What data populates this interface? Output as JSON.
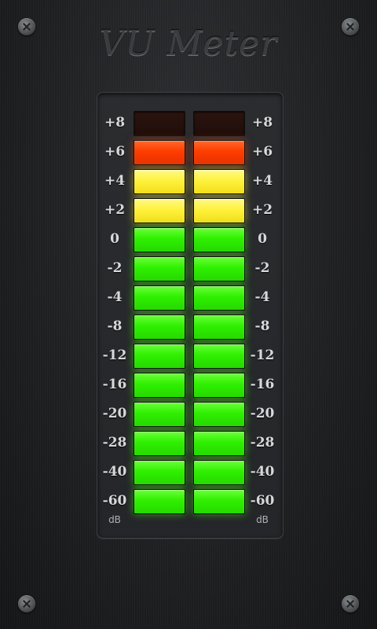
{
  "app": {
    "title": "VU Meter"
  },
  "meter": {
    "unit_left": "dB",
    "unit_right": "dB",
    "rows": [
      {
        "label": "+8",
        "color": "#2b1410",
        "state": "off",
        "left_lit": false,
        "right_lit": false
      },
      {
        "label": "+6",
        "color": "#ff3d00",
        "state": "red",
        "left_lit": true,
        "right_lit": true
      },
      {
        "label": "+4",
        "color": "#fff23d",
        "state": "yellow",
        "left_lit": true,
        "right_lit": true
      },
      {
        "label": "+2",
        "color": "#fff23d",
        "state": "yellow",
        "left_lit": true,
        "right_lit": true
      },
      {
        "label": "0",
        "color": "#2ff000",
        "state": "green",
        "left_lit": true,
        "right_lit": true
      },
      {
        "label": "-2",
        "color": "#2ff000",
        "state": "green",
        "left_lit": true,
        "right_lit": true
      },
      {
        "label": "-4",
        "color": "#2ff000",
        "state": "green",
        "left_lit": true,
        "right_lit": true
      },
      {
        "label": "-8",
        "color": "#2ff000",
        "state": "green",
        "left_lit": true,
        "right_lit": true
      },
      {
        "label": "-12",
        "color": "#2ff000",
        "state": "green",
        "left_lit": true,
        "right_lit": true
      },
      {
        "label": "-16",
        "color": "#2ff000",
        "state": "green",
        "left_lit": true,
        "right_lit": true
      },
      {
        "label": "-20",
        "color": "#2ff000",
        "state": "green",
        "left_lit": true,
        "right_lit": true
      },
      {
        "label": "-28",
        "color": "#2ff000",
        "state": "green",
        "left_lit": true,
        "right_lit": true
      },
      {
        "label": "-40",
        "color": "#2ff000",
        "state": "green",
        "left_lit": true,
        "right_lit": true
      },
      {
        "label": "-60",
        "color": "#2ff000",
        "state": "green",
        "left_lit": true,
        "right_lit": true
      }
    ]
  },
  "icons": [
    "screw-icon"
  ]
}
